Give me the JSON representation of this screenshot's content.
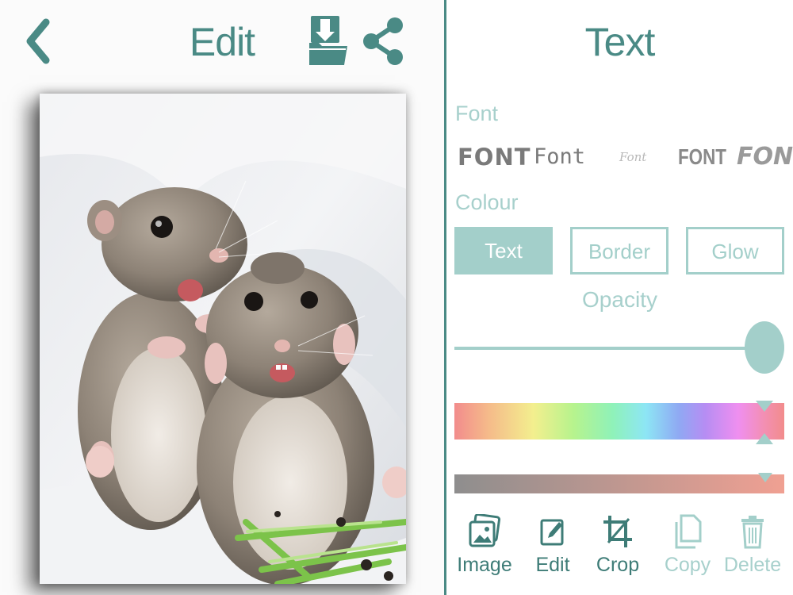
{
  "header": {
    "title": "Edit"
  },
  "panel": {
    "title": "Text",
    "font_label": "Font",
    "font_options": [
      "FONT",
      "Font",
      "Font",
      "FONT",
      "FONT"
    ],
    "colour_label": "Colour",
    "colour_tabs": [
      "Text",
      "Border",
      "Glow"
    ],
    "opacity_label": "Opacity",
    "opacity_value": 1.0
  },
  "toolbar": {
    "image_label": "Image",
    "edit_label": "Edit",
    "crop_label": "Crop",
    "copy_label": "Copy",
    "delete_label": "Delete"
  },
  "colors": {
    "accent": "#4a8a85",
    "accent_light": "#a3cfca"
  },
  "icons": {
    "back": "chevron-left-icon",
    "save": "save-to-folder-icon",
    "share": "share-icon",
    "image": "image-gallery-icon",
    "edit": "pencil-icon",
    "crop": "crop-icon",
    "copy": "copy-icon",
    "delete": "trash-icon"
  }
}
